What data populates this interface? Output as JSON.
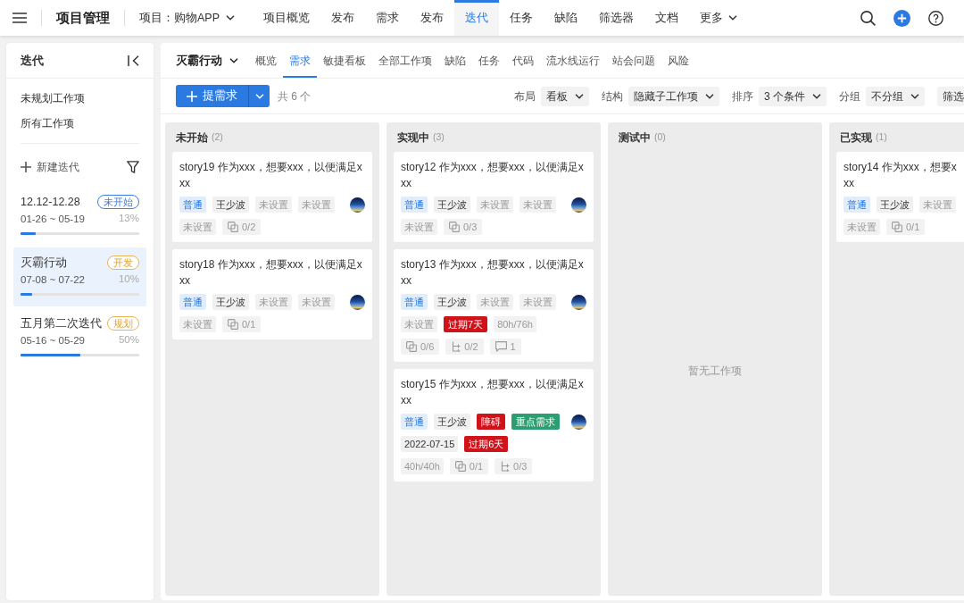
{
  "topbar": {
    "app_title": "项目管理",
    "project": "项目：购物APP",
    "nav": [
      {
        "label": "项目概览",
        "selected": false,
        "has_menu": false
      },
      {
        "label": "发布",
        "selected": false,
        "has_menu": false
      },
      {
        "label": "需求",
        "selected": false,
        "has_menu": false
      },
      {
        "label": "发布",
        "selected": false,
        "has_menu": false
      },
      {
        "label": "迭代",
        "selected": true,
        "has_menu": false
      },
      {
        "label": "任务",
        "selected": false,
        "has_menu": false
      },
      {
        "label": "缺陷",
        "selected": false,
        "has_menu": false
      },
      {
        "label": "筛选器",
        "selected": false,
        "has_menu": false
      },
      {
        "label": "文档",
        "selected": false,
        "has_menu": false
      },
      {
        "label": "更多",
        "selected": false,
        "has_menu": true
      }
    ]
  },
  "sidebar": {
    "title": "迭代",
    "links": [
      "未规划工作项",
      "所有工作项"
    ],
    "new_button": "新建迭代",
    "iterations": [
      {
        "name": "12.12-12.28",
        "status": {
          "label": "未开始",
          "kind": "not_started"
        },
        "dates": "01-26 ~ 05-19",
        "percent": "13%",
        "level": 0.13,
        "selected": false
      },
      {
        "name": "灭霸行动",
        "status": {
          "label": "开发",
          "kind": "developing"
        },
        "dates": "07-08 ~ 07-22",
        "percent": "10%",
        "level": 0.1,
        "selected": true
      },
      {
        "name": "五月第二次迭代",
        "status": {
          "label": "规划",
          "kind": "planning"
        },
        "dates": "05-16 ~ 05-29",
        "percent": "50%",
        "level": 0.5,
        "selected": false
      }
    ]
  },
  "workspace": {
    "iteration": "灭霸行动",
    "tabs": [
      {
        "label": "概览",
        "selected": false
      },
      {
        "label": "需求",
        "selected": true
      },
      {
        "label": "敏捷看板",
        "selected": false
      },
      {
        "label": "全部工作项",
        "selected": false
      },
      {
        "label": "缺陷",
        "selected": false
      },
      {
        "label": "任务",
        "selected": false
      },
      {
        "label": "代码",
        "selected": false
      },
      {
        "label": "流水线运行",
        "selected": false
      },
      {
        "label": "站会问题",
        "selected": false
      },
      {
        "label": "风险",
        "selected": false
      }
    ],
    "create_button": "提需求",
    "count": "共 6 个",
    "view_options": [
      {
        "label": "布局",
        "value": "看板",
        "caret": true
      },
      {
        "label": "结构",
        "value": "隐藏子工作项",
        "caret": true
      },
      {
        "label": "排序",
        "value": "3 个条件",
        "caret": true
      },
      {
        "label": "分组",
        "value": "不分组",
        "caret": true
      },
      {
        "value": "筛选",
        "caret": false
      }
    ]
  },
  "board": {
    "columns": [
      {
        "title": "未开始",
        "count": "(2)",
        "cards": [
          {
            "title": "story19 作为xxx，想要xxx，以便满足xxx",
            "avatar": true,
            "tag_rows": [
              [
                {
                  "kind": "priority",
                  "text": "普通"
                },
                {
                  "kind": "owner",
                  "text": "王少波"
                },
                {
                  "kind": "unset",
                  "text": "未设置"
                },
                {
                  "kind": "unset",
                  "text": "未设置"
                }
              ],
              [
                {
                  "kind": "unset",
                  "text": "未设置"
                },
                {
                  "kind": "subitems",
                  "text": "0/2"
                }
              ]
            ]
          },
          {
            "title": "story18 作为xxx，想要xxx，以便满足xxx",
            "avatar": true,
            "tag_rows": [
              [
                {
                  "kind": "priority",
                  "text": "普通"
                },
                {
                  "kind": "owner",
                  "text": "王少波"
                },
                {
                  "kind": "unset",
                  "text": "未设置"
                },
                {
                  "kind": "unset",
                  "text": "未设置"
                }
              ],
              [
                {
                  "kind": "unset",
                  "text": "未设置"
                },
                {
                  "kind": "subitems",
                  "text": "0/1"
                }
              ]
            ]
          }
        ]
      },
      {
        "title": "实现中",
        "count": "(3)",
        "cards": [
          {
            "title": "story12 作为xxx，想要xxx，以便满足xxx",
            "avatar": true,
            "tag_rows": [
              [
                {
                  "kind": "priority",
                  "text": "普通"
                },
                {
                  "kind": "owner",
                  "text": "王少波"
                },
                {
                  "kind": "unset",
                  "text": "未设置"
                },
                {
                  "kind": "unset",
                  "text": "未设置"
                }
              ],
              [
                {
                  "kind": "unset",
                  "text": "未设置"
                },
                {
                  "kind": "subitems",
                  "text": "0/3"
                }
              ]
            ]
          },
          {
            "title": "story13 作为xxx，想要xxx，以便满足xxx",
            "avatar": true,
            "tag_rows": [
              [
                {
                  "kind": "priority",
                  "text": "普通"
                },
                {
                  "kind": "owner",
                  "text": "王少波"
                },
                {
                  "kind": "unset",
                  "text": "未设置"
                },
                {
                  "kind": "unset",
                  "text": "未设置"
                }
              ],
              [
                {
                  "kind": "unset",
                  "text": "未设置"
                },
                {
                  "kind": "alert",
                  "text": "过期7天"
                },
                {
                  "kind": "hours",
                  "text": "80h/76h"
                }
              ],
              [
                {
                  "kind": "subitems",
                  "text": "0/6"
                },
                {
                  "kind": "subtasks",
                  "text": "0/2"
                },
                {
                  "kind": "comments",
                  "text": "1"
                }
              ]
            ]
          },
          {
            "title": "story15 作为xxx，想要xxx，以便满足xxx",
            "avatar": true,
            "tag_rows": [
              [
                {
                  "kind": "priority",
                  "text": "普通"
                },
                {
                  "kind": "owner",
                  "text": "王少波"
                },
                {
                  "kind": "alert",
                  "text": "障碍"
                },
                {
                  "kind": "highlight",
                  "text": "重点需求"
                }
              ],
              [
                {
                  "kind": "date",
                  "text": "2022-07-15"
                },
                {
                  "kind": "alert",
                  "text": "过期6天"
                }
              ],
              [
                {
                  "kind": "hours",
                  "text": "40h/40h"
                },
                {
                  "kind": "subitems",
                  "text": "0/1"
                },
                {
                  "kind": "subtasks",
                  "text": "0/3"
                }
              ]
            ]
          }
        ]
      },
      {
        "title": "测试中",
        "count": "(0)",
        "empty_text": "暂无工作项"
      },
      {
        "title": "已实现",
        "count": "(1)",
        "cards": [
          {
            "title": "story14 作为xxx，想要xxx",
            "avatar": false,
            "tag_rows": [
              [
                {
                  "kind": "priority",
                  "text": "普通"
                },
                {
                  "kind": "owner",
                  "text": "王少波"
                },
                {
                  "kind": "unset",
                  "text": "未设置"
                }
              ],
              [
                {
                  "kind": "unset",
                  "text": "未设置"
                },
                {
                  "kind": "subitems",
                  "text": "0/1"
                }
              ]
            ]
          }
        ]
      }
    ]
  }
}
